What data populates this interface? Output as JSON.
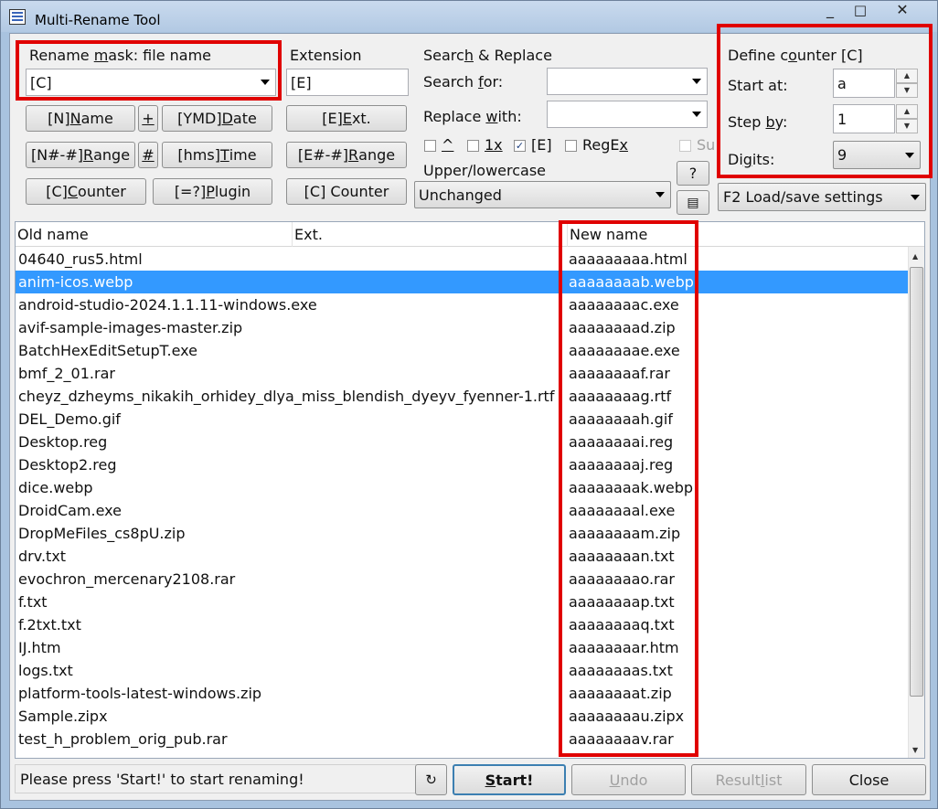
{
  "window": {
    "title": "Multi-Rename Tool",
    "minimize": "_",
    "maximize": "□",
    "close": "✕"
  },
  "rename_mask": {
    "label_pre": "Rename ",
    "label_u": "m",
    "label_post": "ask: file name",
    "value": "[C]"
  },
  "name_buttons": {
    "name_pre": "[N]  ",
    "name_u": "N",
    "name_post": "ame",
    "plus": "+",
    "date_pre": "[YMD]  ",
    "date_u": "D",
    "date_post": "ate",
    "range_pre": "[N#-#]  ",
    "range_u": "R",
    "range_post": "ange",
    "hash": "#",
    "time_pre": "[hms]  ",
    "time_u": "T",
    "time_post": "ime",
    "counter_pre": "[C]  ",
    "counter_u": "C",
    "counter_post": "ounter",
    "plugin_pre": "[=?]  ",
    "plugin_u": "P",
    "plugin_post": "lugin"
  },
  "extension": {
    "label": "Extension",
    "value": "[E]",
    "ext_pre": "[E]  ",
    "ext_u": "E",
    "ext_post": "xt.",
    "range_pre": "[E#-#]  ",
    "range_u": "R",
    "range_post": "ange",
    "counter": "[C]  Counter"
  },
  "search_replace": {
    "label_pre": "Searc",
    "label_u": "h",
    "label_post": " & Replace",
    "search_pre": "Search ",
    "search_u": "f",
    "search_post": "or:",
    "search_value": "",
    "replace_pre": "Replace ",
    "replace_u": "w",
    "replace_post": "ith:",
    "replace_value": "",
    "opt_caret": "^",
    "opt_1x": "1x",
    "opt_e": "[E]",
    "opt_regex_pre": "RegE",
    "opt_regex_u": "x",
    "opt_regex_post": "",
    "opt_subst": "Su",
    "checked_e": "✓"
  },
  "case": {
    "label": "Upper/lowercase",
    "value": "Unchanged",
    "help": "?",
    "copy_icon": "▤"
  },
  "counter": {
    "label_pre": "Define c",
    "label_u": "o",
    "label_post": "unter [C]",
    "start_label": "Start at:",
    "start_value": "a",
    "step_pre": "Step ",
    "step_u": "b",
    "step_post": "y:",
    "step_value": "1",
    "digits_pre": "Di",
    "digits_u": "g",
    "digits_post": "its:",
    "digits_value": "9",
    "spin_up": "▲",
    "spin_down": "▼"
  },
  "load_save": "F2 Load/save settings",
  "list": {
    "headers": {
      "old": "Old name",
      "ext": "Ext.",
      "new": "New name"
    },
    "rows": [
      {
        "old": "04640_rus5.html",
        "new": "aaaaaaaaa.html"
      },
      {
        "old": "anim-icos.webp",
        "new": "aaaaaaaab.webp"
      },
      {
        "old": "android-studio-2024.1.1.11-windows.exe",
        "new": "aaaaaaaac.exe"
      },
      {
        "old": "avif-sample-images-master.zip",
        "new": "aaaaaaaad.zip"
      },
      {
        "old": "BatchHexEditSetupT.exe",
        "new": "aaaaaaaae.exe"
      },
      {
        "old": "bmf_2_01.rar",
        "new": "aaaaaaaaf.rar"
      },
      {
        "old": "cheyz_dzheyms_nikakih_orhidey_dlya_miss_blendish_dyeyv_fyenner-1.rtf",
        "new": "aaaaaaaag.rtf"
      },
      {
        "old": "DEL_Demo.gif",
        "new": "aaaaaaaah.gif"
      },
      {
        "old": "Desktop.reg",
        "new": "aaaaaaaai.reg"
      },
      {
        "old": "Desktop2.reg",
        "new": "aaaaaaaaj.reg"
      },
      {
        "old": "dice.webp",
        "new": "aaaaaaaak.webp"
      },
      {
        "old": "DroidCam.exe",
        "new": "aaaaaaaal.exe"
      },
      {
        "old": "DropMeFiles_cs8pU.zip",
        "new": "aaaaaaaam.zip"
      },
      {
        "old": "drv.txt",
        "new": "aaaaaaaan.txt"
      },
      {
        "old": "evochron_mercenary2108.rar",
        "new": "aaaaaaaao.rar"
      },
      {
        "old": "f.txt",
        "new": "aaaaaaaap.txt"
      },
      {
        "old": "f.2txt.txt",
        "new": "aaaaaaaaq.txt"
      },
      {
        "old": "IJ.htm",
        "new": "aaaaaaaar.htm"
      },
      {
        "old": "logs.txt",
        "new": "aaaaaaaas.txt"
      },
      {
        "old": "platform-tools-latest-windows.zip",
        "new": "aaaaaaaat.zip"
      },
      {
        "old": "Sample.zipx",
        "new": "aaaaaaaau.zipx"
      },
      {
        "old": "test_h_problem_orig_pub.rar",
        "new": "aaaaaaaav.rar"
      }
    ],
    "selected_index": 1
  },
  "status_text": "Please press 'Start!' to start renaming!",
  "buttons": {
    "refresh_icon": "↻",
    "start_u": "S",
    "start_post": "tart!",
    "undo_u": "U",
    "undo_post": "ndo",
    "result_pre": "Result ",
    "result_u": "l",
    "result_post": "ist",
    "close": "Close"
  },
  "colors": {
    "highlight": "#e00000",
    "selection": "#3399ff"
  }
}
